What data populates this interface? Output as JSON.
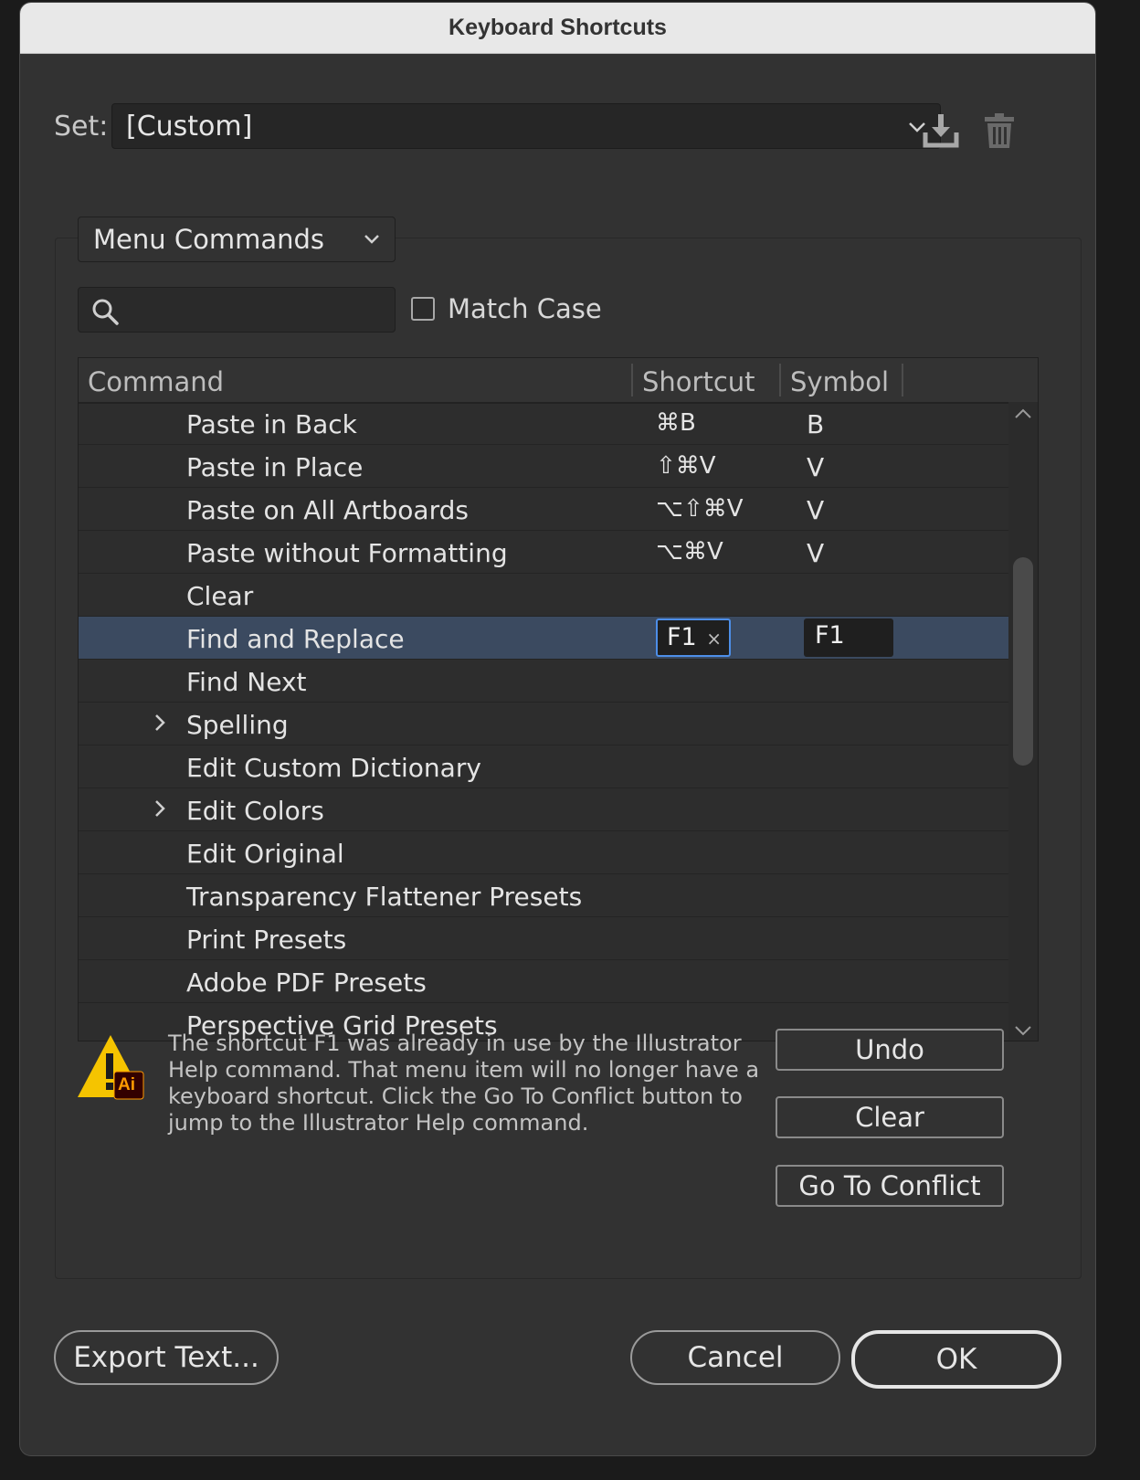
{
  "dialog": {
    "title": "Keyboard Shortcuts"
  },
  "set": {
    "label": "Set:",
    "value": "[Custom]"
  },
  "shortcut_type": {
    "value": "Menu Commands"
  },
  "search": {
    "value": "",
    "placeholder": ""
  },
  "match_case": {
    "label": "Match Case",
    "checked": false
  },
  "table": {
    "headers": {
      "command": "Command",
      "shortcut": "Shortcut",
      "symbol": "Symbol"
    },
    "rows": [
      {
        "command": "Paste in Back",
        "shortcut": "⌘B",
        "symbol": "B",
        "expandable": false
      },
      {
        "command": "Paste in Place",
        "shortcut": "⇧⌘V",
        "symbol": "V",
        "expandable": false
      },
      {
        "command": "Paste on All Artboards",
        "shortcut": "⌥⇧⌘V",
        "symbol": "V",
        "expandable": false
      },
      {
        "command": "Paste without Formatting",
        "shortcut": "⌥⌘V",
        "symbol": "V",
        "expandable": false
      },
      {
        "command": "Clear",
        "shortcut": "",
        "symbol": "",
        "expandable": false
      },
      {
        "command": "Find and Replace",
        "shortcut": "F1",
        "symbol": "F1",
        "expandable": false,
        "selected": true,
        "editing": true
      },
      {
        "command": "Find Next",
        "shortcut": "",
        "symbol": "",
        "expandable": false
      },
      {
        "command": "Spelling",
        "shortcut": "",
        "symbol": "",
        "expandable": true
      },
      {
        "command": "Edit Custom Dictionary",
        "shortcut": "",
        "symbol": "",
        "expandable": false
      },
      {
        "command": "Edit Colors",
        "shortcut": "",
        "symbol": "",
        "expandable": true
      },
      {
        "command": "Edit Original",
        "shortcut": "",
        "symbol": "",
        "expandable": false
      },
      {
        "command": "Transparency Flattener Presets",
        "shortcut": "",
        "symbol": "",
        "expandable": false
      },
      {
        "command": "Print Presets",
        "shortcut": "",
        "symbol": "",
        "expandable": false
      },
      {
        "command": "Adobe PDF Presets",
        "shortcut": "",
        "symbol": "",
        "expandable": false
      },
      {
        "command": "Perspective Grid Presets",
        "shortcut": "",
        "symbol": "",
        "expandable": false
      }
    ],
    "clear_glyph": "×"
  },
  "warning": {
    "badge": "Ai",
    "message": "The shortcut F1 was already in use by the Illustrator Help command. That menu item will no longer have a keyboard shortcut. Click the Go To Conflict button to jump to the Illustrator Help command."
  },
  "side_buttons": {
    "undo": "Undo",
    "clear": "Clear",
    "go_to_conflict": "Go To Conflict"
  },
  "footer": {
    "export": "Export Text...",
    "cancel": "Cancel",
    "ok": "OK"
  },
  "colors": {
    "selection": "#3b4a60",
    "focus": "#4d8ee8",
    "warning": "#f5c400",
    "ai_badge": "#ff9a00"
  },
  "icons": {
    "save_set": "download-icon",
    "delete_set": "trash-icon",
    "search": "search-icon",
    "warning": "warning-icon"
  }
}
